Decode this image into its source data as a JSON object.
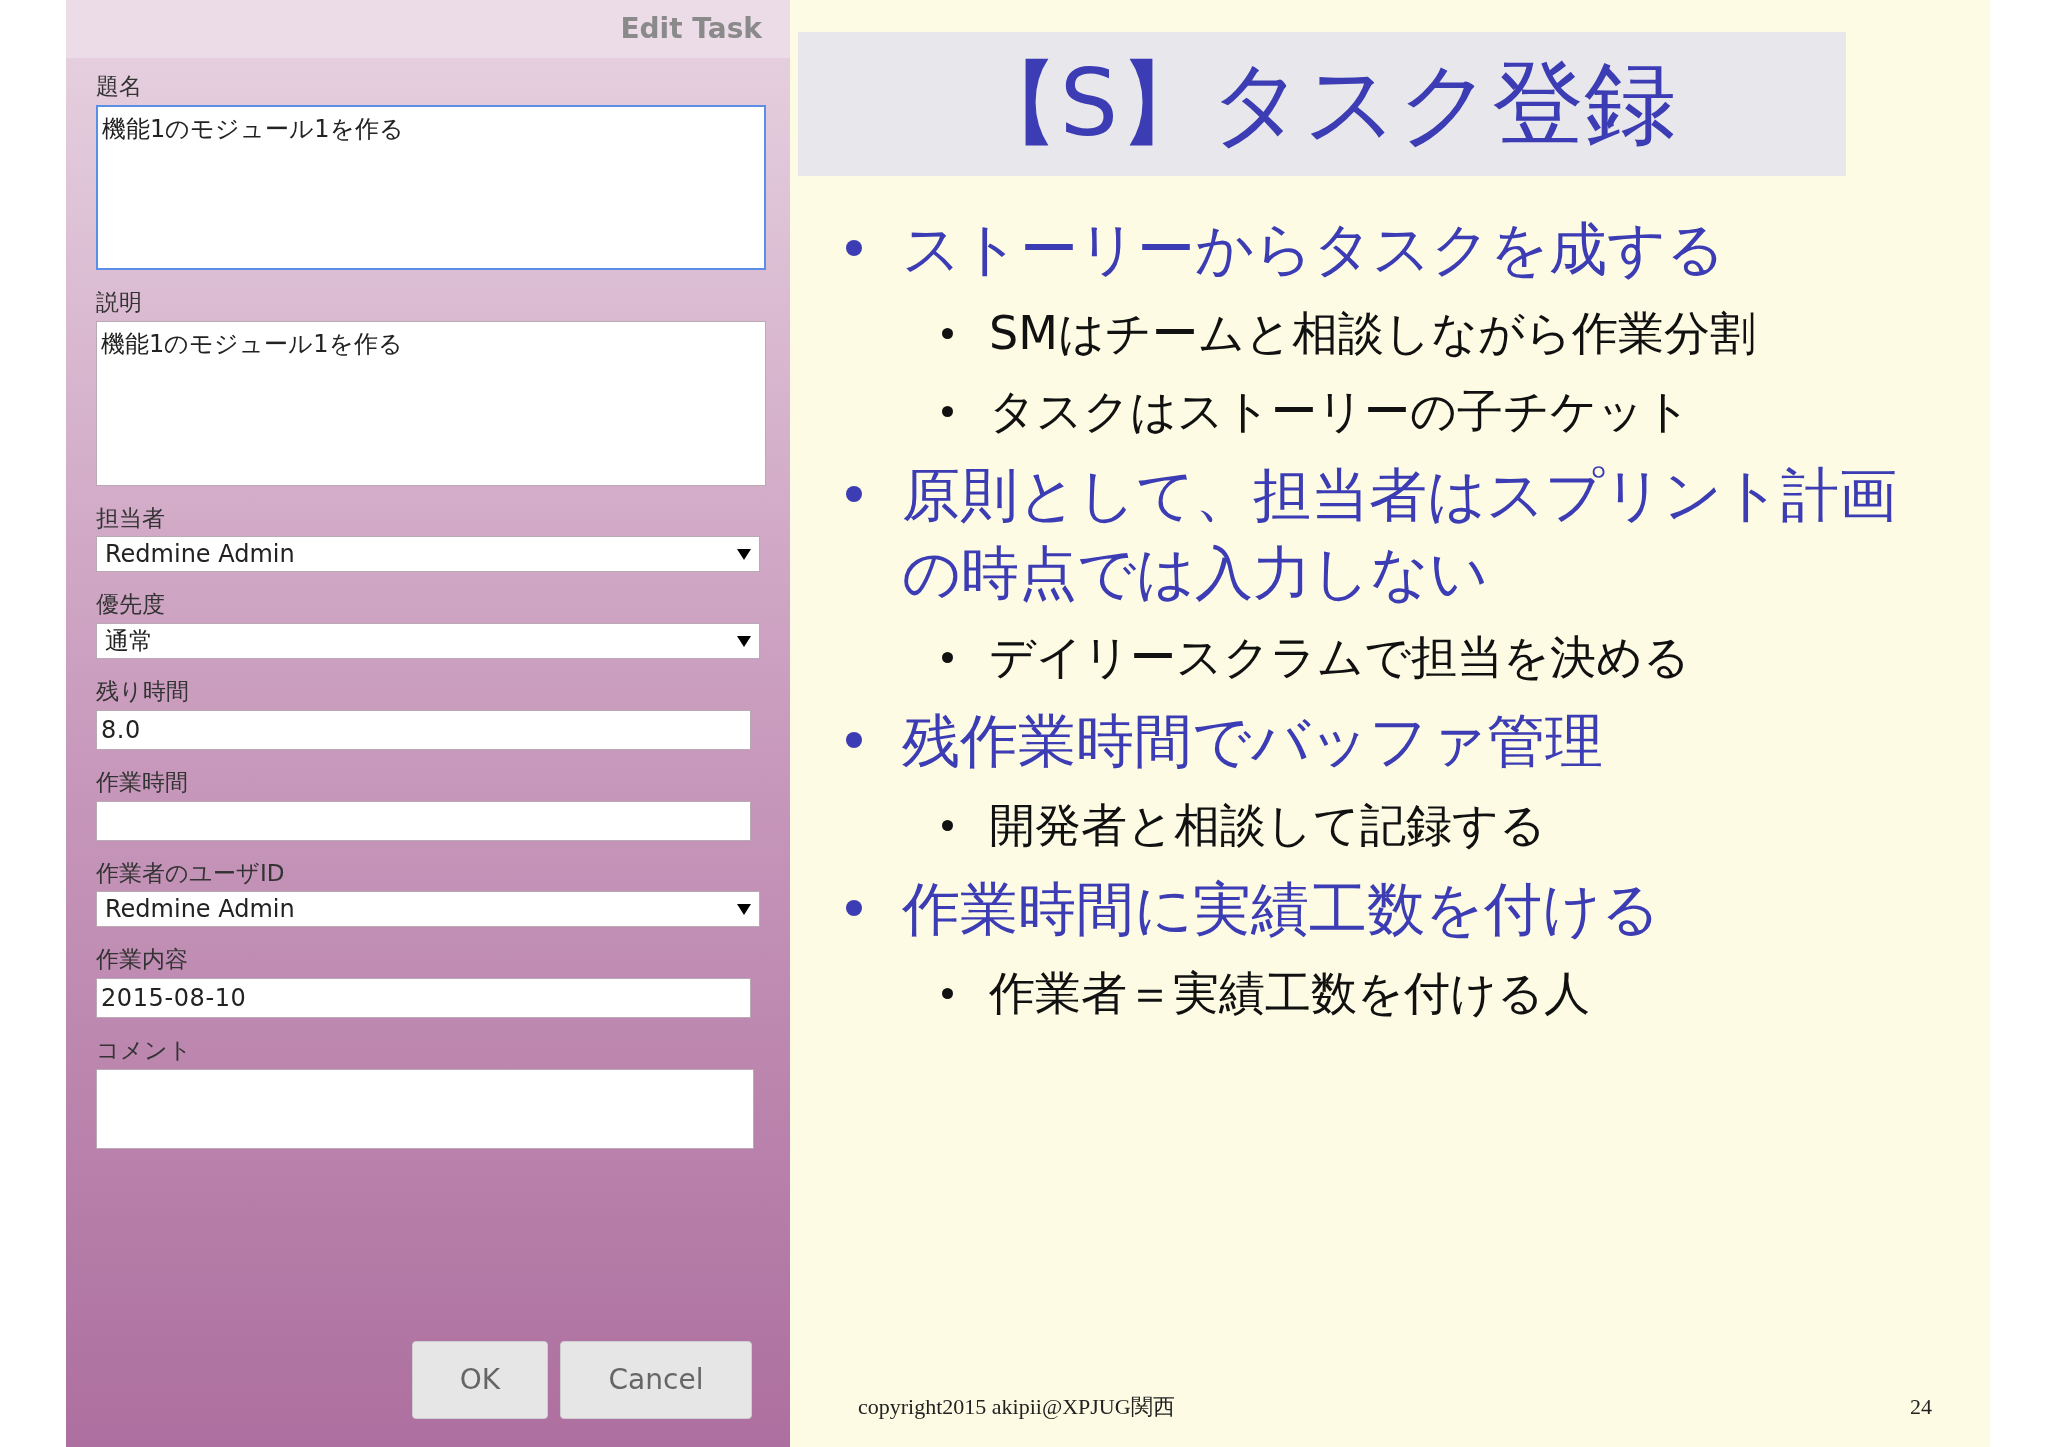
{
  "dialog": {
    "title": "Edit Task",
    "fields": [
      {
        "kind": "textarea",
        "label": "題名",
        "value": "機能1のモジュール1を作る",
        "focused": true
      },
      {
        "kind": "textarea",
        "label": "説明",
        "value": "機能1のモジュール1を作る",
        "focused": false
      },
      {
        "kind": "select",
        "label": "担当者",
        "value": "Redmine Admin",
        "focused": false
      },
      {
        "kind": "select",
        "label": "優先度",
        "value": "通常",
        "focused": false
      },
      {
        "kind": "text",
        "label": "残り時間",
        "value": "8.0",
        "focused": false
      },
      {
        "kind": "text",
        "label": "作業時間",
        "focused": false
      },
      {
        "kind": "select",
        "label": "作業者のユーザID",
        "value": "Redmine Admin",
        "focused": false
      },
      {
        "kind": "text",
        "label": "作業内容",
        "value": "2015-08-10",
        "focused": false
      },
      {
        "kind": "memo",
        "label": "コメント",
        "focused": false
      }
    ],
    "buttons": [
      "OK",
      "Cancel"
    ]
  },
  "slide": {
    "title": "【S】タスク登録",
    "bullets": [
      {
        "text": "ストーリーからタスクを成する",
        "children": [
          {
            "text": "SMはチームと相談しながら作業分割"
          },
          {
            "text": "タスクはストーリーの子チケット"
          }
        ]
      },
      {
        "text": "原則として、担当者はスプリント計画の時点では入力しない",
        "children": [
          {
            "text": "デイリースクラムで担当を決める"
          }
        ]
      },
      {
        "text": "残作業時間でバッファ管理",
        "children": [
          {
            "text": "開発者と相談して記録する"
          }
        ]
      },
      {
        "text": "作業時間に実績工数を付ける",
        "children": [
          {
            "text": "作業者＝実績工数を付ける人"
          }
        ]
      }
    ],
    "footer": "copyright2015 akipii@XPJUG関西",
    "page": "24"
  }
}
